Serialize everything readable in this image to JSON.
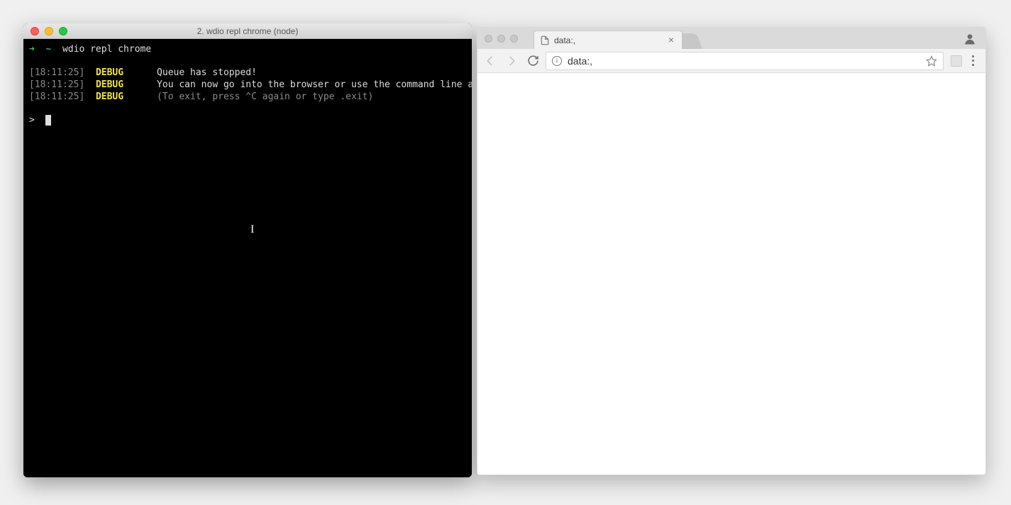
{
  "terminal": {
    "window_title": "2. wdio repl chrome (node)",
    "prompt_arrow": "➜",
    "prompt_tilde": "~",
    "command": "wdio repl chrome",
    "logs": [
      {
        "ts": "[18:11:25]",
        "level": "DEBUG",
        "msg": "Queue has stopped!",
        "dim": false
      },
      {
        "ts": "[18:11:25]",
        "level": "DEBUG",
        "msg": "You can now go into the browser or use the command line as REPL",
        "dim": false
      },
      {
        "ts": "[18:11:25]",
        "level": "DEBUG",
        "msg": "(To exit, press ^C again or type .exit)",
        "dim": true
      }
    ],
    "repl_prompt": ">"
  },
  "chrome": {
    "tab_title": "data:,",
    "url": "data:,"
  }
}
